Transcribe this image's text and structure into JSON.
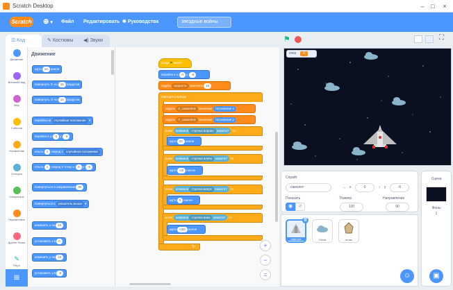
{
  "window": {
    "title": "Scratch Desktop"
  },
  "menu": {
    "logo": "Scratch",
    "globe_caret": "▾",
    "file": "Файл",
    "edit": "Редактировать",
    "tutorials": "Руководства",
    "project_title": "звездные войны"
  },
  "tabs": {
    "code": "Код",
    "costumes": "Костюмы",
    "sounds": "Звуки"
  },
  "categories": [
    {
      "label": "Движение",
      "color": "#4c97ff"
    },
    {
      "label": "Внешний вид",
      "color": "#9966ff"
    },
    {
      "label": "Звук",
      "color": "#cf63cf"
    },
    {
      "label": "События",
      "color": "#ffbf00"
    },
    {
      "label": "Управление",
      "color": "#ffab19"
    },
    {
      "label": "Сенсоры",
      "color": "#5cb1d6"
    },
    {
      "label": "Операторы",
      "color": "#59c059"
    },
    {
      "label": "Переменные",
      "color": "#ff8c1a"
    },
    {
      "label": "Другие блоки",
      "color": "#ff6680"
    },
    {
      "label": "Перо",
      "color": "#0fbd8c"
    }
  ],
  "palette": {
    "heading": "Движение",
    "move": {
      "a": "идти",
      "v": "10",
      "b": "шагов"
    },
    "turn_right": {
      "a": "повернуть",
      "v": "15",
      "b": "градусов"
    },
    "turn_left": {
      "a": "повернуть",
      "v": "15",
      "b": "градусов"
    },
    "goto": {
      "a": "перейти на",
      "d": "случайное положение"
    },
    "goto_xy": {
      "a": "перейти в x:",
      "x": "0",
      "b": "y:",
      "y": "-6"
    },
    "glide": {
      "a": "плыть",
      "v": "1",
      "b": "секунд к",
      "d": "случайное положение"
    },
    "glide_xy": {
      "a": "плыть",
      "v": "1",
      "b": "секунд в точку x:",
      "x": "0",
      "c": "y:",
      "y": "-6"
    },
    "point_dir": {
      "a": "повернуться в направлении",
      "v": "90"
    },
    "point_to": {
      "a": "повернуться к",
      "d": "указатель мыши"
    },
    "change_x": {
      "a": "изменить x на",
      "v": "10"
    },
    "set_x": {
      "a": "установить x в",
      "v": "0"
    },
    "change_y": {
      "a": "изменить y на",
      "v": "10"
    },
    "set_y": {
      "a": "установить у в",
      "v": "-6"
    }
  },
  "script": {
    "hat": {
      "a": "когда",
      "b": "нажат"
    },
    "goto_xy": {
      "a": "перейти в x:",
      "x": "0",
      "b": "y:",
      "y": "-6"
    },
    "set_var": {
      "a": "задать",
      "d": "скорость",
      "b": "значение",
      "v": "10"
    },
    "forever": "повторять всегда",
    "set_x": {
      "a": "задать",
      "d": "X_самолета",
      "b": "значение",
      "v": "положение x"
    },
    "set_y": {
      "a": "задать",
      "d": "Y_самолета",
      "b": "значение",
      "v": "положение y"
    },
    "if1": {
      "a": "если",
      "b": "клавиша",
      "d": "стрелка вправо",
      "c": "нажата?",
      "e": "то"
    },
    "move1": {
      "a": "идти",
      "v": "10",
      "b": "шагов"
    },
    "if2": {
      "a": "если",
      "b": "клавиша",
      "d": "стрелка влево",
      "c": "нажата?",
      "e": "то"
    },
    "move2": {
      "a": "идти",
      "v": "-10",
      "b": "шагов"
    },
    "if3": {
      "a": "если",
      "b": "клавиша",
      "d": "стрелка вверх",
      "c": "нажата?",
      "e": "то"
    },
    "move3": {
      "a": "идти",
      "v": "5",
      "b": "шагов"
    },
    "if4": {
      "a": "если",
      "b": "клавиша",
      "d": "стрелка вниз",
      "c": "нажата?",
      "e": "то"
    },
    "move4": {
      "a": "идти",
      "v": "-150",
      "b": "шагов"
    }
  },
  "zoom": {
    "in": "+",
    "out": "−",
    "reset": "="
  },
  "stage": {
    "score_label": "очки",
    "score_value": "0"
  },
  "sprite_info": {
    "sprite_label": "Спрайт",
    "sprite_name": "самолет",
    "x_label": "x",
    "x_value": "0",
    "y_label": "y",
    "y_value": "-6",
    "show_label": "Показать",
    "size_label": "Размер",
    "size_value": "100",
    "direction_label": "Направление",
    "direction_value": "90"
  },
  "sprites": [
    {
      "name": "самолет"
    },
    {
      "name": "Cloud"
    },
    {
      "name": "огонь"
    }
  ],
  "stage_panel": {
    "title": "Сцена",
    "backdrops_label": "Фоны",
    "backdrops_count": "1"
  },
  "colors": {
    "accent": "#4c97ff",
    "stage_bg": "#0a1020",
    "variable": "#ff8c1a"
  }
}
